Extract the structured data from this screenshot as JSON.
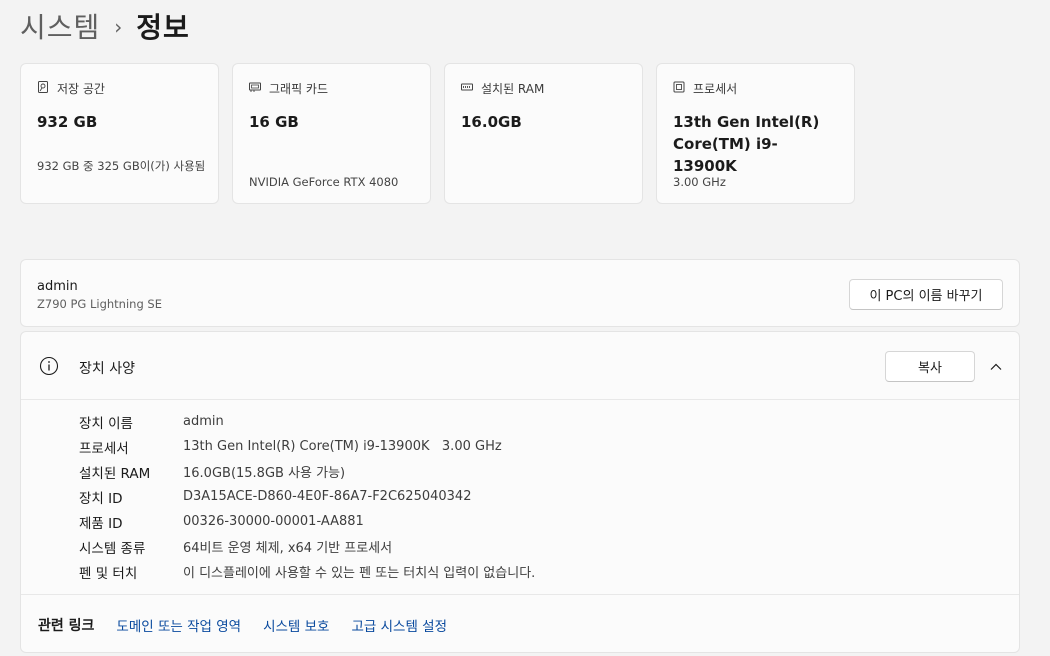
{
  "breadcrumb": {
    "parent": "시스템",
    "separator": "›",
    "current": "정보"
  },
  "cards": [
    {
      "icon": "storage-icon",
      "title": "저장 공간",
      "value": "932 GB",
      "sub": "932 GB 중 325 GB이(가) 사용됨"
    },
    {
      "icon": "graphics-card-icon",
      "title": "그래픽 카드",
      "value": "16 GB",
      "sub": "NVIDIA GeForce RTX 4080"
    },
    {
      "icon": "ram-icon",
      "title": "설치된 RAM",
      "value": "16.0GB",
      "sub": ""
    },
    {
      "icon": "processor-icon",
      "title": "프로세서",
      "value": "13th Gen Intel(R) Core(TM) i9-13900K",
      "sub": "3.00 GHz"
    }
  ],
  "device": {
    "name": "admin",
    "model": "Z790 PG Lightning SE",
    "rename_label": "이 PC의 이름 바꾸기"
  },
  "spec": {
    "title": "장치 사양",
    "copy_label": "복사",
    "rows": [
      {
        "label": "장치 이름",
        "value": "admin"
      },
      {
        "label": "프로세서",
        "value": "13th Gen Intel(R) Core(TM) i9-13900K   3.00 GHz"
      },
      {
        "label": "설치된 RAM",
        "value": "16.0GB(15.8GB 사용 가능)"
      },
      {
        "label": "장치 ID",
        "value": "D3A15ACE-D860-4E0F-86A7-F2C625040342"
      },
      {
        "label": "제품 ID",
        "value": "00326-30000-00001-AA881"
      },
      {
        "label": "시스템 종류",
        "value": "64비트 운영 체제, x64 기반 프로세서"
      },
      {
        "label": "펜 및 터치",
        "value": "이 디스플레이에 사용할 수 있는 펜 또는 터치식 입력이 없습니다."
      }
    ]
  },
  "related_links": {
    "label": "관련 링크",
    "links": [
      "도메인 또는 작업 영역",
      "시스템 보호",
      "고급 시스템 설정"
    ]
  },
  "colors": {
    "background": "#f3f3f3",
    "card": "#fbfbfb",
    "link": "#0a4a9e"
  }
}
